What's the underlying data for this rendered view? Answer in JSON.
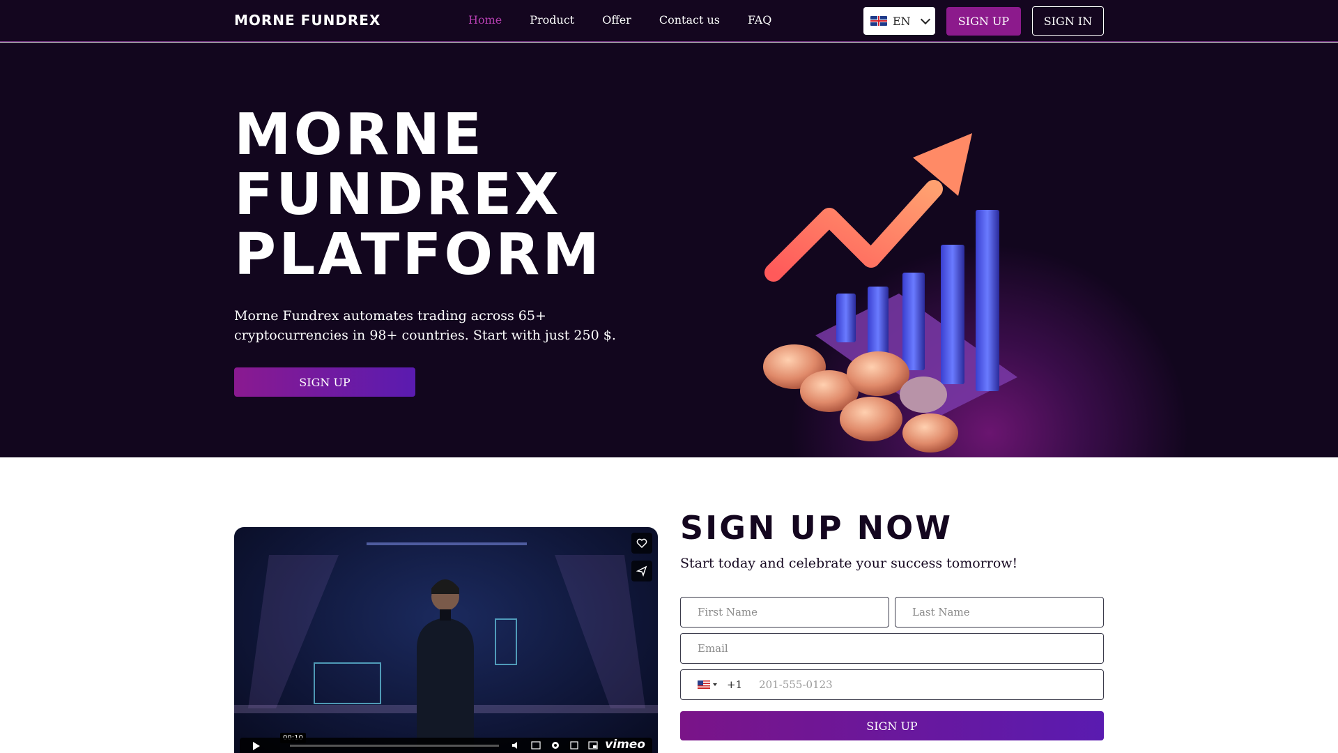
{
  "brand": {
    "name": "MORNE FUNDREX"
  },
  "nav": {
    "items": [
      {
        "label": "Home",
        "active": true
      },
      {
        "label": "Product"
      },
      {
        "label": "Offer"
      },
      {
        "label": "Contact us"
      },
      {
        "label": "FAQ"
      }
    ],
    "language": {
      "code": "EN",
      "flag": "uk-flag-icon"
    },
    "signup_label": "SIGN UP",
    "signin_label": "SIGN IN"
  },
  "hero": {
    "title_lines": [
      "MORNE",
      "FUNDREX",
      "PLATFORM"
    ],
    "description": "Morne Fundrex automates trading across 65+ cryptocurrencies in 98+ countries. Start with just 250 $.",
    "cta_label": "SIGN UP"
  },
  "video": {
    "time": "00:10",
    "provider": "vimeo"
  },
  "signup": {
    "title": "SIGN UP NOW",
    "subtitle": "Start today and celebrate your success tomorrow!",
    "first_name_placeholder": "First Name",
    "last_name_placeholder": "Last Name",
    "email_placeholder": "Email",
    "dial_code": "+1",
    "phone_placeholder": "201-555-0123",
    "submit_label": "SIGN UP"
  },
  "colors": {
    "accent": "#8c1a8c",
    "nav_bg": "#14061f",
    "active_link": "#b53fb0"
  }
}
